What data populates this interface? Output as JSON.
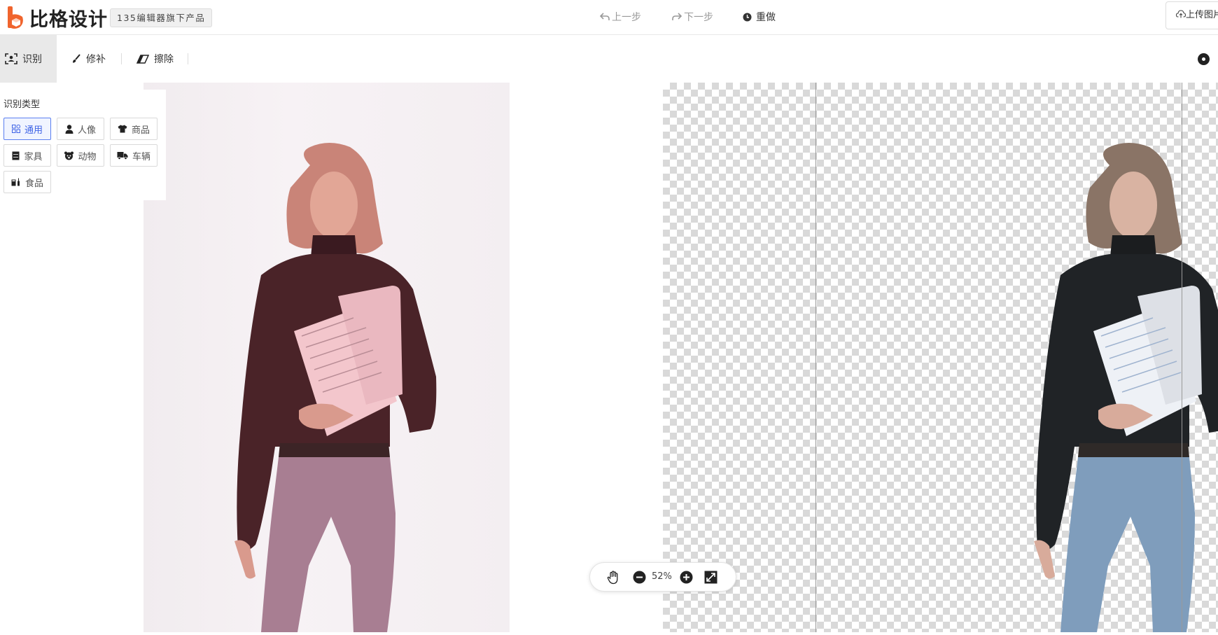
{
  "header": {
    "logo_text": "比格设计",
    "sub_badge": "135编辑器旗下产品",
    "undo_label": "上一步",
    "redo_label": "下一步",
    "reset_label": "重做",
    "upload_label": "上传图片"
  },
  "toolbar": {
    "identify_label": "识别",
    "repair_label": "修补",
    "erase_label": "擦除"
  },
  "type_panel": {
    "title": "识别类型",
    "types": [
      {
        "label": "通用",
        "icon": "grid-icon",
        "active": true
      },
      {
        "label": "人像",
        "icon": "person-icon",
        "active": false
      },
      {
        "label": "商品",
        "icon": "shirt-icon",
        "active": false
      },
      {
        "label": "家具",
        "icon": "cabinet-icon",
        "active": false
      },
      {
        "label": "动物",
        "icon": "animal-icon",
        "active": false
      },
      {
        "label": "车辆",
        "icon": "truck-icon",
        "active": false
      },
      {
        "label": "食品",
        "icon": "food-icon",
        "active": false
      }
    ]
  },
  "zoom": {
    "value": "52%"
  },
  "colors": {
    "accent": "#3f64e6",
    "logo_orange": "#f0642d",
    "muted": "#999999"
  }
}
